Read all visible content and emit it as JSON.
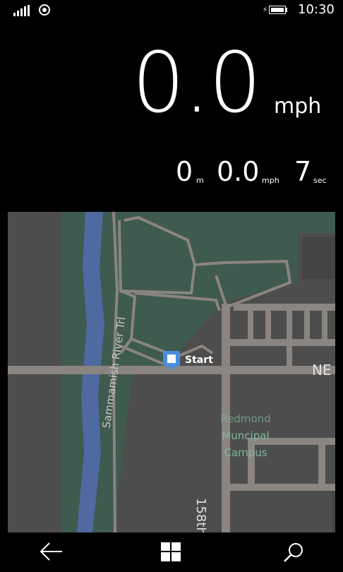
{
  "status_bar": {
    "time": "10:30",
    "icons": [
      "signal-strength-icon",
      "wifi-icon",
      "battery-charging-icon"
    ]
  },
  "speed": {
    "current": "0.0",
    "unit": "mph"
  },
  "stats": [
    {
      "value": "0",
      "unit": "m"
    },
    {
      "value": "0.0",
      "unit": "mph"
    },
    {
      "value": "7",
      "unit": "sec"
    }
  ],
  "map": {
    "labels": {
      "trail": "Sammamish River Trl",
      "campus_line1": "Redmond",
      "campus_line2": "Muncipal",
      "campus_line3": "Campus",
      "street_ne": "NE",
      "street_158": "158th"
    },
    "marker_label": "Start",
    "colors": {
      "land": "#4d4d4d",
      "park": "#3f5a4f",
      "water": "#4f6aa0",
      "road": "#8a8580"
    }
  },
  "navbar": {
    "icons": [
      "back-arrow-icon",
      "windows-start-icon",
      "search-icon"
    ]
  }
}
